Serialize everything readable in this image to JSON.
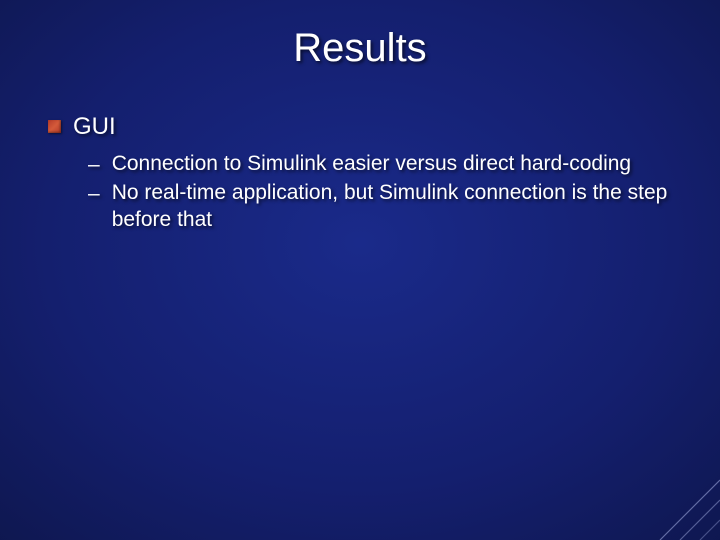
{
  "title": "Results",
  "bullets": {
    "lvl1": {
      "text": "GUI"
    },
    "lvl2": [
      {
        "text": "Connection to Simulink easier versus direct hard-coding"
      },
      {
        "text": "No real-time application, but Simulink connection is the step before that"
      }
    ]
  }
}
